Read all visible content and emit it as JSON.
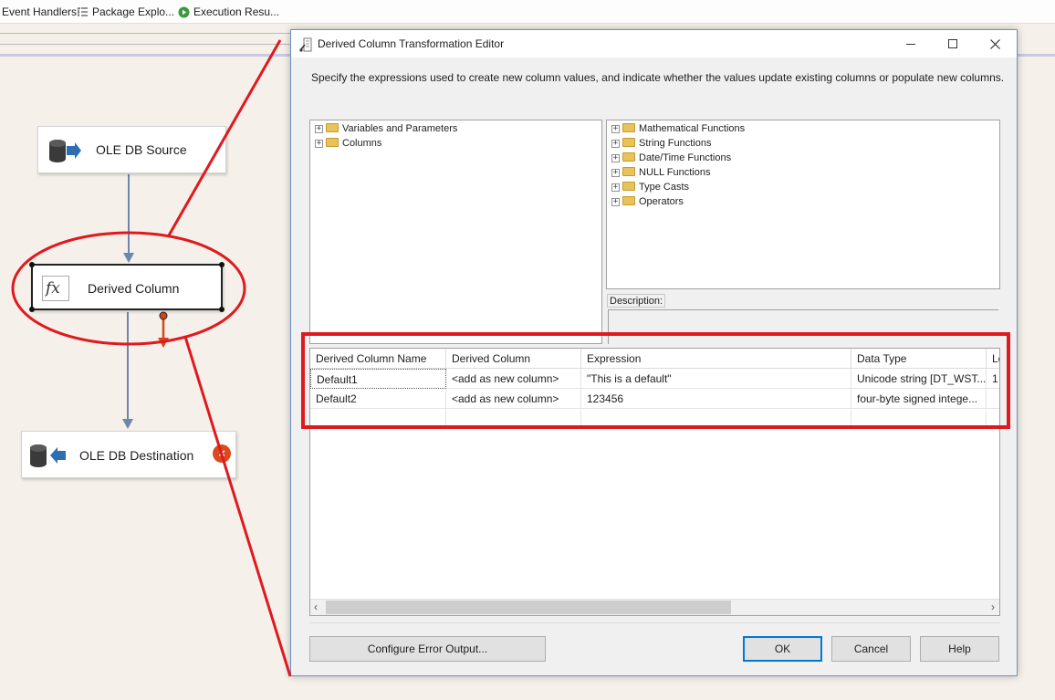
{
  "toolbar": {
    "tabs": [
      {
        "label": "Event Handlers"
      },
      {
        "label": "Package Explo..."
      },
      {
        "label": "Execution Resu..."
      }
    ]
  },
  "designer": {
    "source": {
      "label": "OLE DB Source"
    },
    "derived": {
      "label": "Derived Column",
      "icon_text": "fx"
    },
    "destination": {
      "label": "OLE DB Destination"
    }
  },
  "dialog": {
    "title": "Derived Column Transformation Editor",
    "instruction": "Specify the expressions used to create new column values, and indicate whether the values update existing columns or populate new columns.",
    "left_tree": [
      {
        "label": "Variables and Parameters"
      },
      {
        "label": "Columns"
      }
    ],
    "right_tree": [
      {
        "label": "Mathematical Functions"
      },
      {
        "label": "String Functions"
      },
      {
        "label": "Date/Time Functions"
      },
      {
        "label": "NULL Functions"
      },
      {
        "label": "Type Casts"
      },
      {
        "label": "Operators"
      }
    ],
    "description_label": "Description:",
    "grid": {
      "headers": [
        "Derived Column Name",
        "Derived Column",
        "Expression",
        "Data Type",
        "Le"
      ],
      "rows": [
        [
          "Default1",
          "<add as new column>",
          "\"This is a default\"",
          "Unicode string [DT_WST...",
          "1"
        ],
        [
          "Default2",
          "<add as new column>",
          "123456",
          "four-byte signed intege...",
          ""
        ]
      ]
    },
    "buttons": {
      "configure": "Configure Error Output...",
      "ok": "OK",
      "cancel": "Cancel",
      "help": "Help"
    }
  },
  "colors": {
    "annotation_red": "#e0191f",
    "accent_blue": "#0078d7",
    "connector": "#6e85ad"
  }
}
